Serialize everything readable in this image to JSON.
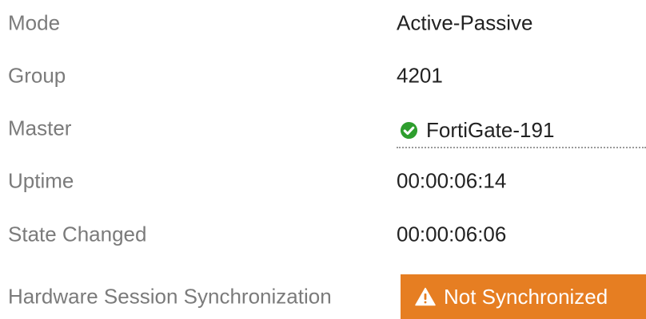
{
  "ha_status": {
    "rows": [
      {
        "label": "Mode",
        "value": "Active-Passive"
      },
      {
        "label": "Group",
        "value": "4201"
      },
      {
        "label": "Master",
        "value": "FortiGate-191",
        "icon": "check-circle-icon",
        "icon_color": "#2e9e2e"
      },
      {
        "label": "Uptime",
        "value": "00:00:06:14"
      },
      {
        "label": "State Changed",
        "value": "00:00:06:06"
      },
      {
        "label": "Hardware Session Synchronization",
        "value": "Not Synchronized",
        "icon": "warning-icon",
        "badge_color": "#e67e22"
      }
    ]
  }
}
